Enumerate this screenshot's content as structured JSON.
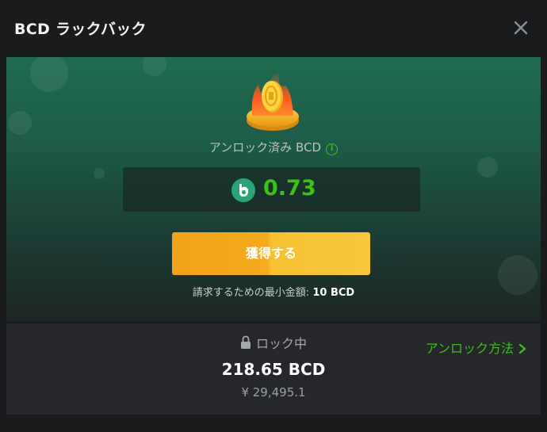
{
  "modal": {
    "title": "BCD ラックバック",
    "close_icon": "close-icon"
  },
  "hero": {
    "illustration_icon": "coin-fire-icon",
    "unlocked_label": "アンロック済み BCD",
    "info_icon": "info-icon",
    "info_glyph": "i",
    "currency_icon": "bcd-coin-icon",
    "amount": "0.73",
    "claim_button": "獲得する",
    "min_label": "請求するための最小金額:",
    "min_value": "10 BCD"
  },
  "locked": {
    "label": "ロック中",
    "lock_icon": "lock-icon",
    "amount": "218.65 BCD",
    "fiat": "¥ 29,495.1",
    "how_link": "アンロック方法",
    "chevron_icon": "chevron-right-icon"
  },
  "colors": {
    "accent_green": "#3bc117",
    "button_orange": "#f4ab1c",
    "background": "#1a1b1d",
    "panel": "#25272b"
  }
}
